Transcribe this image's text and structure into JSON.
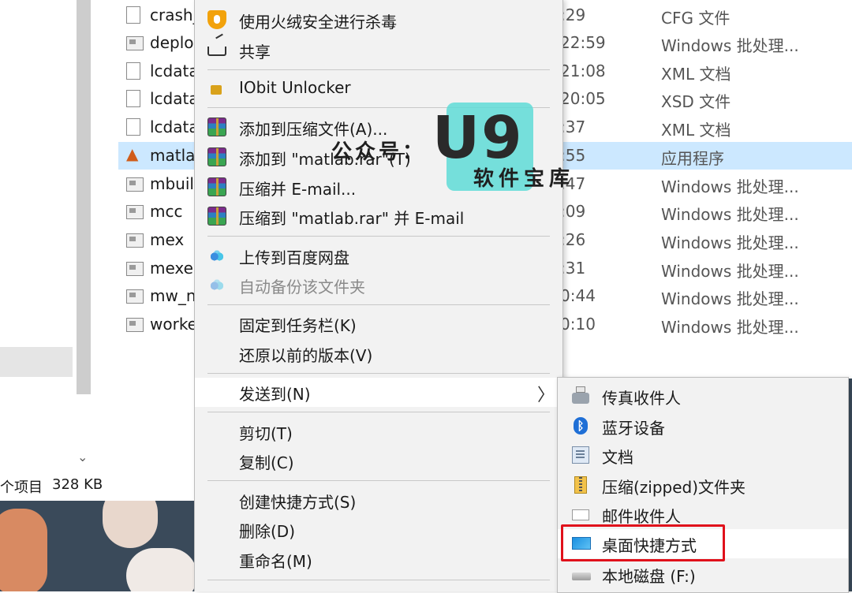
{
  "explorer": {
    "files": [
      {
        "name": "crash_",
        "time": ":29",
        "type": "CFG 文件",
        "icon": "file-icon",
        "selected": false
      },
      {
        "name": "deplo",
        "time": "22:59",
        "type": "Windows 批处理...",
        "icon": "batch-file-icon",
        "selected": false
      },
      {
        "name": "lcdata",
        "time": "21:08",
        "type": "XML 文档",
        "icon": "file-icon",
        "selected": false
      },
      {
        "name": "lcdata",
        "time": "20:05",
        "type": "XSD 文件",
        "icon": "file-icon",
        "selected": false
      },
      {
        "name": "lcdata",
        "time": ":37",
        "type": "XML 文档",
        "icon": "file-icon",
        "selected": false
      },
      {
        "name": "matla",
        "time": ":55",
        "type": "应用程序",
        "icon": "matlab-icon",
        "selected": true
      },
      {
        "name": "mbuil",
        "time": ":47",
        "type": "Windows 批处理...",
        "icon": "batch-file-icon",
        "selected": false
      },
      {
        "name": "mcc",
        "time": ":09",
        "type": "Windows 批处理...",
        "icon": "batch-file-icon",
        "selected": false
      },
      {
        "name": "mex",
        "time": ":26",
        "type": "Windows 批处理...",
        "icon": "batch-file-icon",
        "selected": false
      },
      {
        "name": "mexe",
        "time": ":31",
        "type": "Windows 批处理...",
        "icon": "batch-file-icon",
        "selected": false
      },
      {
        "name": "mw_n",
        "time": "0:44",
        "type": "Windows 批处理...",
        "icon": "batch-file-icon",
        "selected": false
      },
      {
        "name": "worke",
        "time": "0:10",
        "type": "Windows 批处理...",
        "icon": "batch-file-icon",
        "selected": false
      }
    ],
    "status": {
      "count_suffix": "个项目",
      "size": "328 KB"
    },
    "scroll_arrow": "⌄"
  },
  "context_menu": {
    "items": [
      {
        "label": "使用火绒安全进行杀毒",
        "icon": "shield-icon"
      },
      {
        "label": "共享",
        "icon": "share-icon"
      },
      {
        "label": "IObit Unlocker",
        "icon": "unlock-icon"
      },
      {
        "label": "添加到压缩文件(A)...",
        "icon": "winrar-icon"
      },
      {
        "label": "添加到 \"matlab.rar\"(T)",
        "icon": "winrar-icon"
      },
      {
        "label": "压缩并 E-mail...",
        "icon": "winrar-icon"
      },
      {
        "label": "压缩到 \"matlab.rar\" 并 E-mail",
        "icon": "winrar-icon"
      },
      {
        "label": "上传到百度网盘",
        "icon": "baidu-cloud-icon"
      },
      {
        "label": "自动备份该文件夹",
        "icon": "baidu-cloud-icon",
        "disabled": true
      },
      {
        "label": "固定到任务栏(K)"
      },
      {
        "label": "还原以前的版本(V)"
      },
      {
        "label": "发送到(N)",
        "highlighted": true,
        "submenu_arrow": "〉"
      },
      {
        "label": "剪切(T)"
      },
      {
        "label": "复制(C)"
      },
      {
        "label": "创建快捷方式(S)"
      },
      {
        "label": "删除(D)"
      },
      {
        "label": "重命名(M)"
      }
    ]
  },
  "send_to_menu": {
    "items": [
      {
        "label": "传真收件人",
        "icon": "fax-icon"
      },
      {
        "label": "蓝牙设备",
        "icon": "bluetooth-icon"
      },
      {
        "label": "文档",
        "icon": "documents-icon"
      },
      {
        "label": "压缩(zipped)文件夹",
        "icon": "zip-folder-icon"
      },
      {
        "label": "邮件收件人",
        "icon": "mail-icon"
      },
      {
        "label": "桌面快捷方式",
        "icon": "desktop-icon",
        "highlighted": true
      },
      {
        "label": "本地磁盘 (F:)",
        "icon": "drive-icon"
      }
    ]
  },
  "watermark": {
    "logo_text": "U9",
    "label": "公众号：",
    "subtitle": "软件宝库"
  },
  "colors": {
    "selection": "#cce8ff",
    "menu_bg": "#f2f2f2",
    "highlight_box": "#e0111b",
    "watermark": "#5fdcd7"
  }
}
